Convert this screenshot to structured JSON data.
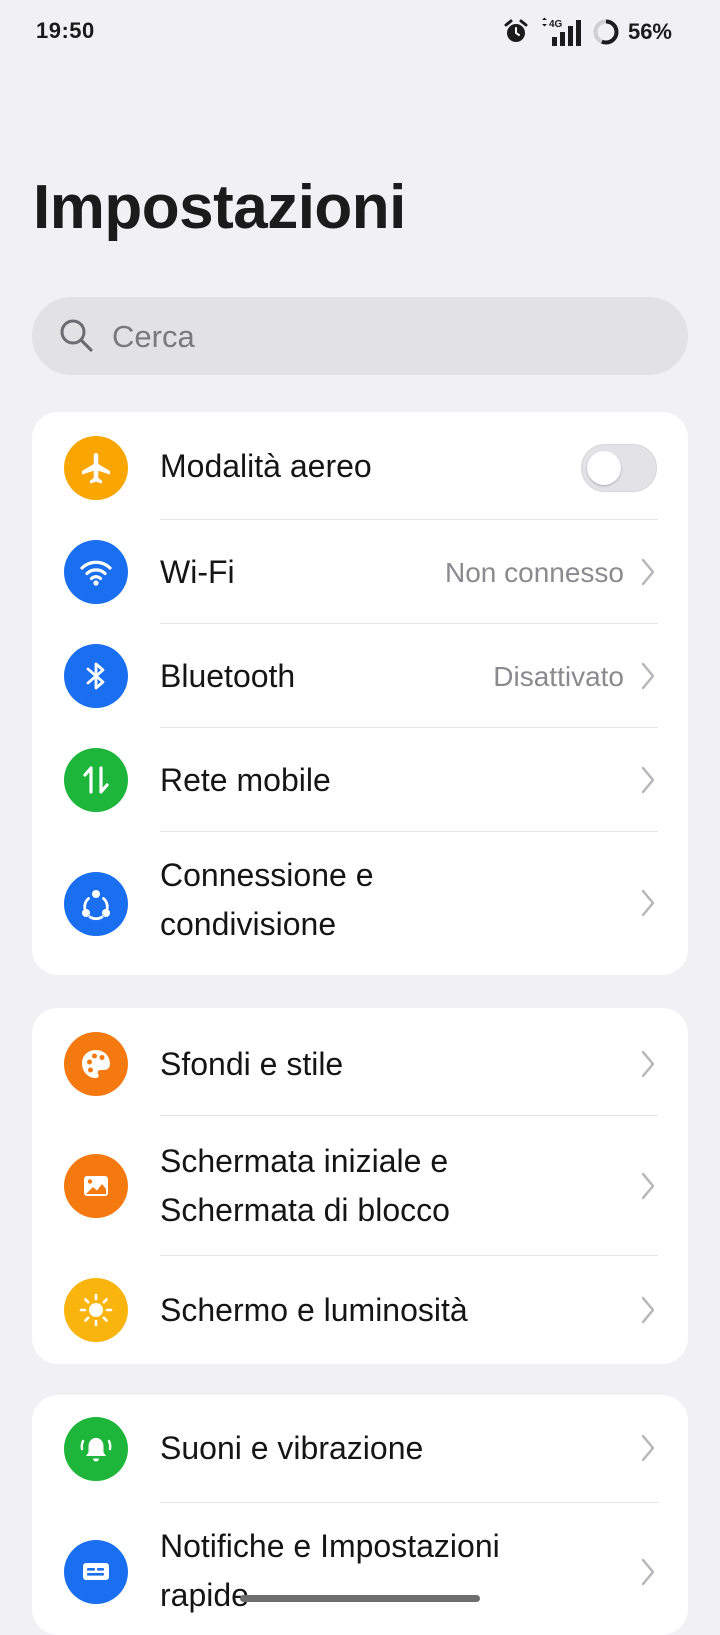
{
  "status_bar": {
    "time": "19:50",
    "network": "4G",
    "battery": "56%"
  },
  "page_title": "Impostazioni",
  "search": {
    "placeholder": "Cerca"
  },
  "groups": [
    {
      "items": [
        {
          "label": "Modalità aereo",
          "control": "toggle",
          "toggle_on": false,
          "icon": "airplane-icon",
          "color": "#f9a602"
        },
        {
          "label": "Wi-Fi",
          "value": "Non connesso",
          "icon": "wifi-icon",
          "color": "#1a6ff0"
        },
        {
          "label": "Bluetooth",
          "value": "Disattivato",
          "icon": "bluetooth-icon",
          "color": "#1a6ff0"
        },
        {
          "label": "Rete mobile",
          "icon": "mobile-data-icon",
          "color": "#1db53a"
        },
        {
          "label_lines": [
            "Connessione e",
            "condivisione"
          ],
          "icon": "share-network-icon",
          "color": "#1a6ff0"
        }
      ]
    },
    {
      "items": [
        {
          "label": "Sfondi e stile",
          "icon": "palette-icon",
          "color": "#f47a0f"
        },
        {
          "label_lines": [
            "Schermata iniziale e",
            "Schermata di blocco"
          ],
          "icon": "wallpaper-icon",
          "color": "#f47a0f"
        },
        {
          "label": "Schermo e luminosità",
          "icon": "sun-icon",
          "color": "#f9b40e"
        }
      ]
    },
    {
      "items": [
        {
          "label": "Suoni e vibrazione",
          "icon": "bell-ringing-icon",
          "color": "#1db53a"
        },
        {
          "label_lines": [
            "Notifiche e Impostazioni",
            "rapide"
          ],
          "icon": "notification-icon",
          "color": "#1a6ff0"
        }
      ]
    }
  ]
}
